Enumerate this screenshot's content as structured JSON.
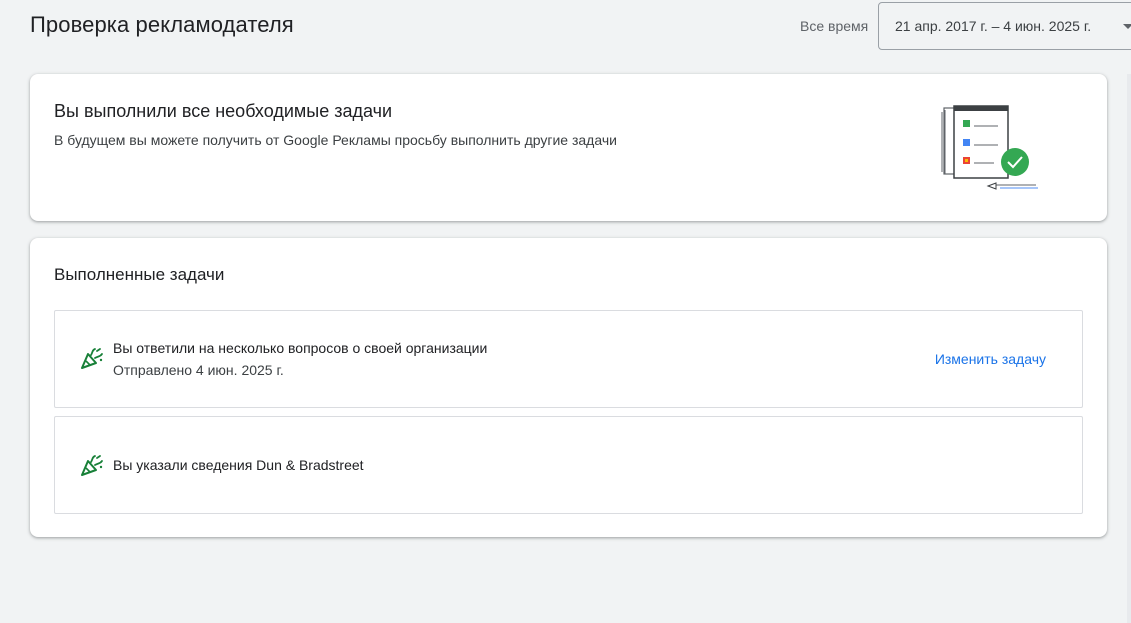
{
  "header": {
    "title": "Проверка рекламодателя",
    "date_range_label": "Все время",
    "date_range_value": "21 апр. 2017 г. – 4 июн. 2025 г."
  },
  "summary": {
    "heading": "Вы выполнили все необходимые задачи",
    "subtext": "В будущем вы можете получить от Google Рекламы просьбу выполнить другие задачи",
    "illustration_icon": "completed-checklist-illustration"
  },
  "completed": {
    "heading": "Выполненные задачи",
    "tasks": [
      {
        "title": "Вы ответили на несколько вопросов о своей организации",
        "meta": "Отправлено 4 июн. 2025 г.",
        "action": "Изменить задачу",
        "icon": "celebration-icon"
      },
      {
        "title": "Вы указали сведения Dun & Bradstreet",
        "icon": "celebration-icon"
      }
    ]
  },
  "colors": {
    "accent": "#1a73e8",
    "success": "#34a853",
    "icon_green": "#188038",
    "background": "#f1f3f4"
  }
}
